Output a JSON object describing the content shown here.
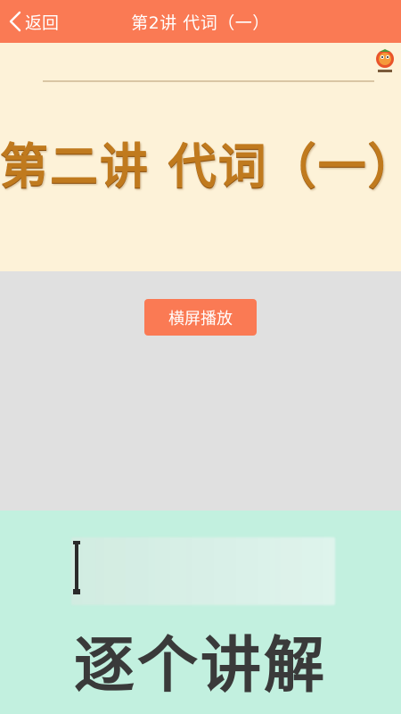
{
  "header": {
    "back_label": "返回",
    "title": "第2讲 代词（一）",
    "background": "#fa7a54"
  },
  "slide": {
    "heading": "第二讲 代词（一）",
    "logo": "mascot-logo"
  },
  "controls": {
    "landscape_label": "横屏播放"
  },
  "promo": {
    "headline": "逐个讲解",
    "background": "#c2f0df"
  }
}
